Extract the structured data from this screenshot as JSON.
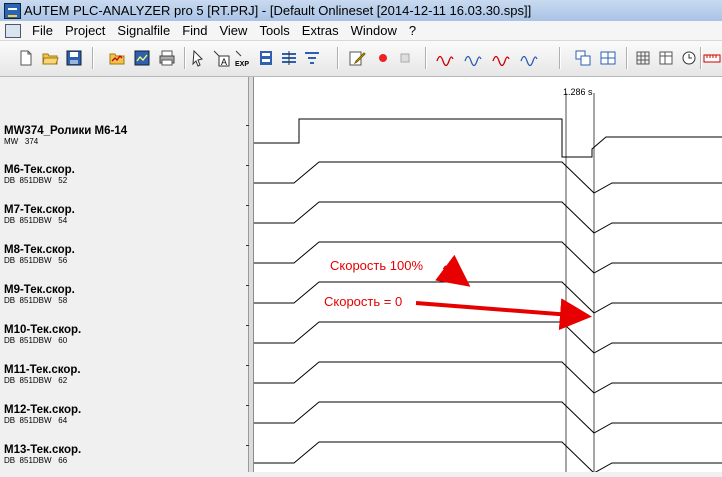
{
  "window": {
    "title": "AUTEM PLC-ANALYZER pro 5 [RT.PRJ] - [Default Onlineset [2014-12-11 16.03.30.sps]]",
    "app_icon": "plc-analyzer-app-icon"
  },
  "menu": [
    "File",
    "Project",
    "Signalfile",
    "Find",
    "View",
    "Tools",
    "Extras",
    "Window",
    "?"
  ],
  "toolbar": {
    "groups": [
      [
        "new-icon",
        "open-folder-icon",
        "save-icon"
      ],
      [
        "open-signalfile-icon",
        "save-signalfile-icon",
        "print-icon"
      ],
      [
        "cursor-icon",
        "text-marker-icon",
        "export-icon",
        "channel-icon",
        "stack-icon",
        "filter-icon"
      ],
      [
        "edit-icon",
        "record-icon",
        "stop-icon"
      ],
      [
        "wave-icon",
        "wave-icon",
        "wave-icon",
        "wave-icon"
      ],
      [
        "window-layout-icon",
        "split-view-icon"
      ],
      [
        "grid-icon",
        "table-icon",
        "clock-icon"
      ],
      [
        "ruler-icon"
      ]
    ]
  },
  "cursor_label": "1.286 s",
  "signals": [
    {
      "name": "MW374_Ролики М6-14",
      "addr": "MW   374",
      "type": "step"
    },
    {
      "name": "М6-Тек.скор.",
      "addr": "DB  851DBW   52",
      "type": "ramp"
    },
    {
      "name": "М7-Тек.скор.",
      "addr": "DB  851DBW   54",
      "type": "ramp"
    },
    {
      "name": "М8-Тек.скор.",
      "addr": "DB  851DBW   56",
      "type": "ramp"
    },
    {
      "name": "М9-Тек.скор.",
      "addr": "DB  851DBW   58",
      "type": "ramp"
    },
    {
      "name": "М10-Тек.скор.",
      "addr": "DB  851DBW   60",
      "type": "ramp"
    },
    {
      "name": "М11-Тек.скор.",
      "addr": "DB  851DBW   62",
      "type": "ramp"
    },
    {
      "name": "М12-Тек.скор.",
      "addr": "DB  851DBW   64",
      "type": "ramp"
    },
    {
      "name": "М13-Тек.скор.",
      "addr": "DB  851DBW   66",
      "type": "ramp"
    }
  ],
  "annotations": {
    "speed_full": "Скорость 100%",
    "speed_zero": "Скорость = 0",
    "color": "#e60000"
  }
}
